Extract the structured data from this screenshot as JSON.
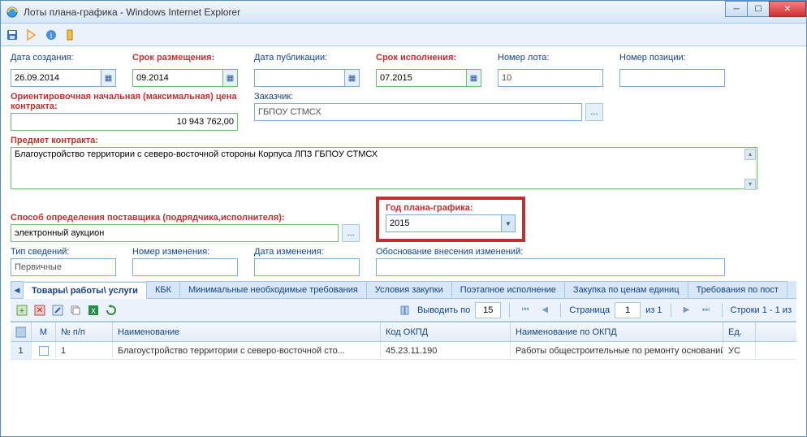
{
  "window": {
    "title": "Лоты плана-графика - Windows Internet Explorer"
  },
  "labels": {
    "create_date": "Дата создания:",
    "place_term": "Срок размещения:",
    "pub_date": "Дата публикации:",
    "exec_term": "Срок исполнения:",
    "lot_no": "Номер лота:",
    "pos_no": "Номер позиции:",
    "init_price": "Ориентировочная начальная (максимальная) цена контракта:",
    "customer": "Заказчик:",
    "subject": "Предмет контракта:",
    "method": "Способ определения поставщика (подрядчика,исполнителя):",
    "plan_year": "Год плана-графика:",
    "info_type": "Тип сведений:",
    "change_no": "Номер изменения:",
    "change_date": "Дата изменения:",
    "change_reason": "Обоснование внесения изменений:"
  },
  "values": {
    "create_date": "26.09.2014",
    "place_term": "09.2014",
    "pub_date": "",
    "exec_term": "07.2015",
    "lot_no": "10",
    "pos_no": "",
    "init_price": "10 943 762,00",
    "customer": "ГБПОУ СТМСХ",
    "subject": "Благоустройство территории с северо-восточной стороны Корпуса ЛПЗ ГБПОУ СТМСХ",
    "method": "электронный аукцион",
    "plan_year": "2015",
    "info_type": "Первичные",
    "change_no": "",
    "change_date": "",
    "change_reason": ""
  },
  "tabs": {
    "items": [
      "Товары\\ работы\\ услуги",
      "КБК",
      "Минимальные необходимые требования",
      "Условия закупки",
      "Поэтапное исполнение",
      "Закупка по ценам единиц",
      "Требования по пост"
    ]
  },
  "grid_toolbar": {
    "show_by": "Выводить по",
    "show_by_val": "15",
    "page": "Страница",
    "page_val": "1",
    "page_of": "из 1",
    "rows_info": "Строки 1 - 1 из"
  },
  "grid": {
    "columns": [
      "",
      "М",
      "№ п/п",
      "Наименование",
      "Код ОКПД",
      "Наименование по ОКПД",
      "Ед."
    ],
    "rows": [
      {
        "n": "1",
        "npp": "1",
        "name": "Благоустройство территории с северо-восточной сто...",
        "okpd": "45.23.11.190",
        "okpd_name": "Работы общестроительные по ремонту оснований пок...",
        "unit": "УС"
      }
    ]
  }
}
